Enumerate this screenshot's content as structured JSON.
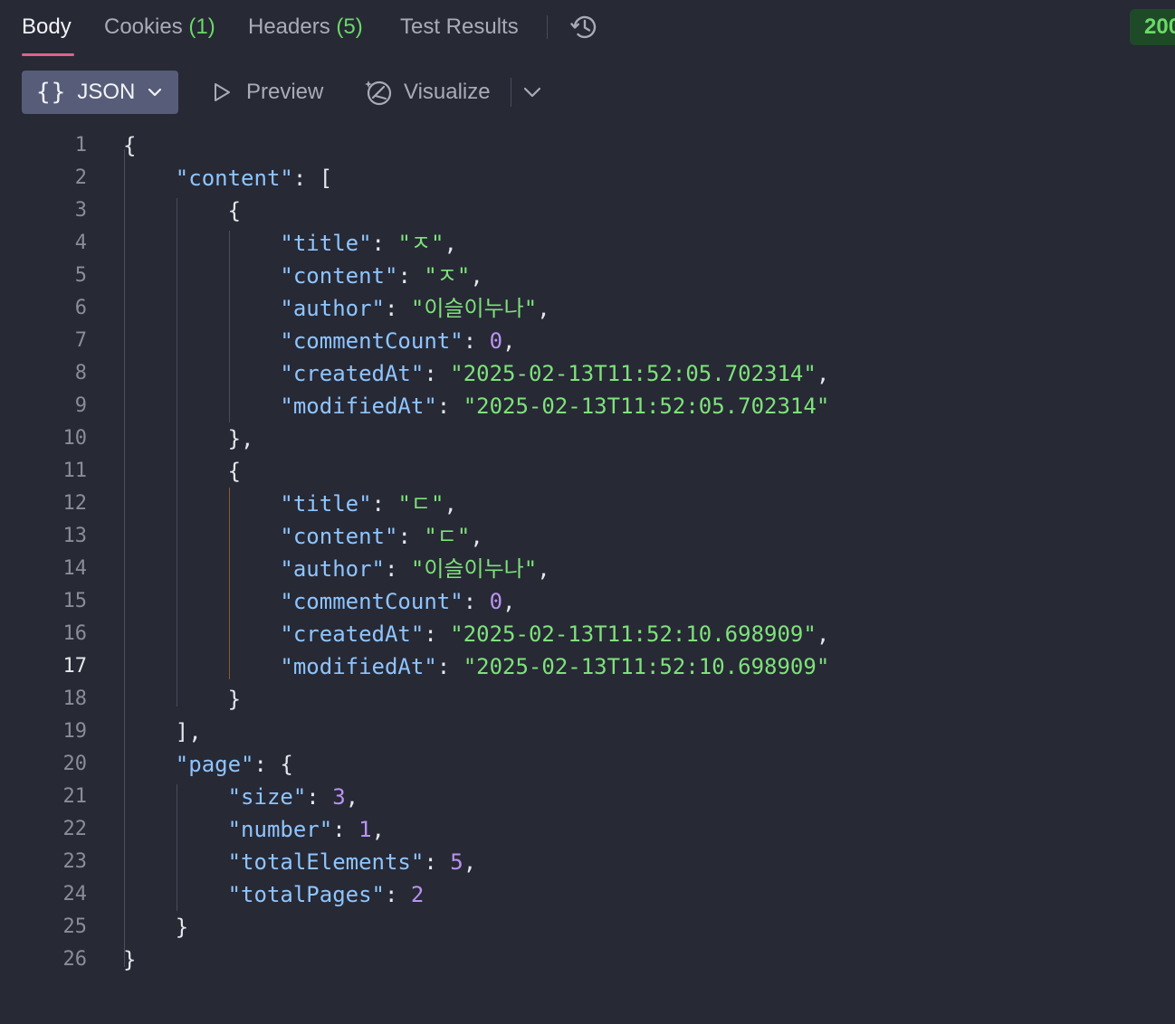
{
  "tabs": {
    "body": "Body",
    "cookies": "Cookies",
    "cookies_count": "(1)",
    "headers": "Headers",
    "headers_count": "(5)",
    "test_results": "Test Results"
  },
  "status": "200",
  "toolbar": {
    "format_label": "JSON",
    "preview_label": "Preview",
    "visualize_label": "Visualize"
  },
  "icons": {
    "history": "history-icon",
    "braces": "braces-icon",
    "chevron": "chevron-down-icon",
    "preview": "play-icon",
    "visualize": "visualize-icon"
  },
  "colors": {
    "key": "#8ec5ff",
    "string": "#7ee27a",
    "number": "#b993f0",
    "active_tab_underline": "#e0628a",
    "status_green": "#6bd968"
  },
  "editor": {
    "current_line": 17,
    "lines": [
      [
        {
          "t": "p",
          "v": "{"
        }
      ],
      [
        {
          "t": "p",
          "v": "    "
        },
        {
          "t": "k",
          "v": "\"content\""
        },
        {
          "t": "p",
          "v": ": ["
        }
      ],
      [
        {
          "t": "p",
          "v": "        {"
        }
      ],
      [
        {
          "t": "p",
          "v": "            "
        },
        {
          "t": "k",
          "v": "\"title\""
        },
        {
          "t": "p",
          "v": ": "
        },
        {
          "t": "s",
          "v": "\"ㅈ\""
        },
        {
          "t": "p",
          "v": ","
        }
      ],
      [
        {
          "t": "p",
          "v": "            "
        },
        {
          "t": "k",
          "v": "\"content\""
        },
        {
          "t": "p",
          "v": ": "
        },
        {
          "t": "s",
          "v": "\"ㅈ\""
        },
        {
          "t": "p",
          "v": ","
        }
      ],
      [
        {
          "t": "p",
          "v": "            "
        },
        {
          "t": "k",
          "v": "\"author\""
        },
        {
          "t": "p",
          "v": ": "
        },
        {
          "t": "s",
          "v": "\"이슬이누나\""
        },
        {
          "t": "p",
          "v": ","
        }
      ],
      [
        {
          "t": "p",
          "v": "            "
        },
        {
          "t": "k",
          "v": "\"commentCount\""
        },
        {
          "t": "p",
          "v": ": "
        },
        {
          "t": "n",
          "v": "0"
        },
        {
          "t": "p",
          "v": ","
        }
      ],
      [
        {
          "t": "p",
          "v": "            "
        },
        {
          "t": "k",
          "v": "\"createdAt\""
        },
        {
          "t": "p",
          "v": ": "
        },
        {
          "t": "s",
          "v": "\"2025-02-13T11:52:05.702314\""
        },
        {
          "t": "p",
          "v": ","
        }
      ],
      [
        {
          "t": "p",
          "v": "            "
        },
        {
          "t": "k",
          "v": "\"modifiedAt\""
        },
        {
          "t": "p",
          "v": ": "
        },
        {
          "t": "s",
          "v": "\"2025-02-13T11:52:05.702314\""
        }
      ],
      [
        {
          "t": "p",
          "v": "        },"
        }
      ],
      [
        {
          "t": "p",
          "v": "        {"
        }
      ],
      [
        {
          "t": "p",
          "v": "            "
        },
        {
          "t": "k",
          "v": "\"title\""
        },
        {
          "t": "p",
          "v": ": "
        },
        {
          "t": "s",
          "v": "\"ㄷ\""
        },
        {
          "t": "p",
          "v": ","
        }
      ],
      [
        {
          "t": "p",
          "v": "            "
        },
        {
          "t": "k",
          "v": "\"content\""
        },
        {
          "t": "p",
          "v": ": "
        },
        {
          "t": "s",
          "v": "\"ㄷ\""
        },
        {
          "t": "p",
          "v": ","
        }
      ],
      [
        {
          "t": "p",
          "v": "            "
        },
        {
          "t": "k",
          "v": "\"author\""
        },
        {
          "t": "p",
          "v": ": "
        },
        {
          "t": "s",
          "v": "\"이슬이누나\""
        },
        {
          "t": "p",
          "v": ","
        }
      ],
      [
        {
          "t": "p",
          "v": "            "
        },
        {
          "t": "k",
          "v": "\"commentCount\""
        },
        {
          "t": "p",
          "v": ": "
        },
        {
          "t": "n",
          "v": "0"
        },
        {
          "t": "p",
          "v": ","
        }
      ],
      [
        {
          "t": "p",
          "v": "            "
        },
        {
          "t": "k",
          "v": "\"createdAt\""
        },
        {
          "t": "p",
          "v": ": "
        },
        {
          "t": "s",
          "v": "\"2025-02-13T11:52:10.698909\""
        },
        {
          "t": "p",
          "v": ","
        }
      ],
      [
        {
          "t": "p",
          "v": "            "
        },
        {
          "t": "k",
          "v": "\"modifiedAt\""
        },
        {
          "t": "p",
          "v": ": "
        },
        {
          "t": "s",
          "v": "\"2025-02-13T11:52:10.698909\""
        }
      ],
      [
        {
          "t": "p",
          "v": "        }"
        }
      ],
      [
        {
          "t": "p",
          "v": "    ],"
        }
      ],
      [
        {
          "t": "p",
          "v": "    "
        },
        {
          "t": "k",
          "v": "\"page\""
        },
        {
          "t": "p",
          "v": ": {"
        }
      ],
      [
        {
          "t": "p",
          "v": "        "
        },
        {
          "t": "k",
          "v": "\"size\""
        },
        {
          "t": "p",
          "v": ": "
        },
        {
          "t": "n",
          "v": "3"
        },
        {
          "t": "p",
          "v": ","
        }
      ],
      [
        {
          "t": "p",
          "v": "        "
        },
        {
          "t": "k",
          "v": "\"number\""
        },
        {
          "t": "p",
          "v": ": "
        },
        {
          "t": "n",
          "v": "1"
        },
        {
          "t": "p",
          "v": ","
        }
      ],
      [
        {
          "t": "p",
          "v": "        "
        },
        {
          "t": "k",
          "v": "\"totalElements\""
        },
        {
          "t": "p",
          "v": ": "
        },
        {
          "t": "n",
          "v": "5"
        },
        {
          "t": "p",
          "v": ","
        }
      ],
      [
        {
          "t": "p",
          "v": "        "
        },
        {
          "t": "k",
          "v": "\"totalPages\""
        },
        {
          "t": "p",
          "v": ": "
        },
        {
          "t": "n",
          "v": "2"
        }
      ],
      [
        {
          "t": "p",
          "v": "    }"
        }
      ],
      [
        {
          "t": "p",
          "v": "}"
        }
      ]
    ]
  }
}
